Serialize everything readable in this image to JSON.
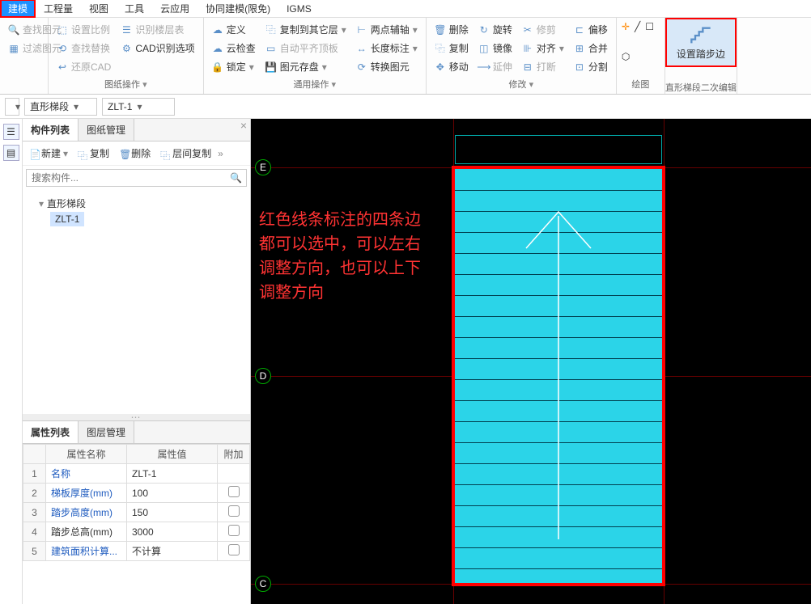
{
  "menu": {
    "tabs": [
      "建模",
      "工程量",
      "视图",
      "工具",
      "云应用",
      "协同建模(限免)",
      "IGMS"
    ],
    "active": 0
  },
  "ribbon": {
    "groups": [
      {
        "label": "",
        "items": [
          {
            "label": "查找图元",
            "icon": "🔍",
            "disabled": true
          },
          {
            "label": "过滤图元",
            "icon": "▦",
            "disabled": true
          }
        ]
      },
      {
        "label": "图纸操作",
        "items": [
          {
            "label": "设置比例",
            "icon": "⬚",
            "disabled": true
          },
          {
            "label": "查找替换",
            "icon": "⟲",
            "disabled": true
          },
          {
            "label": "还原CAD",
            "icon": "↩",
            "disabled": true
          },
          {
            "label": "识别楼层表",
            "icon": "☰",
            "disabled": true
          },
          {
            "label": "CAD识别选项",
            "icon": "⚙",
            "disabled": false
          }
        ]
      },
      {
        "label": "通用操作",
        "items": [
          {
            "label": "定义",
            "icon": "☁",
            "disabled": false
          },
          {
            "label": "云检查",
            "icon": "☁",
            "disabled": false
          },
          {
            "label": "锁定",
            "icon": "🔒",
            "disabled": false
          },
          {
            "label": "复制到其它层",
            "icon": "⿻",
            "disabled": false
          },
          {
            "label": "自动平齐顶板",
            "icon": "▭",
            "disabled": true
          },
          {
            "label": "图元存盘",
            "icon": "💾",
            "disabled": false
          },
          {
            "label": "两点辅轴",
            "icon": "⊢",
            "disabled": false
          },
          {
            "label": "长度标注",
            "icon": "↔",
            "disabled": false
          },
          {
            "label": "转换图元",
            "icon": "⟳",
            "disabled": false
          }
        ]
      },
      {
        "label": "修改",
        "items": [
          {
            "label": "删除",
            "icon": "🗑",
            "disabled": false
          },
          {
            "label": "复制",
            "icon": "⿻",
            "disabled": false
          },
          {
            "label": "移动",
            "icon": "✥",
            "disabled": false
          },
          {
            "label": "旋转",
            "icon": "↻",
            "disabled": false
          },
          {
            "label": "镜像",
            "icon": "◫",
            "disabled": false
          },
          {
            "label": "延伸",
            "icon": "⟶",
            "disabled": true
          },
          {
            "label": "修剪",
            "icon": "✂",
            "disabled": true
          },
          {
            "label": "对齐",
            "icon": "⊪",
            "disabled": false
          },
          {
            "label": "打断",
            "icon": "⊟",
            "disabled": true
          },
          {
            "label": "偏移",
            "icon": "⊏",
            "disabled": false
          },
          {
            "label": "合并",
            "icon": "⊞",
            "disabled": false
          },
          {
            "label": "分割",
            "icon": "⊡",
            "disabled": false
          }
        ]
      },
      {
        "label": "绘图",
        "items": [
          {
            "label": "",
            "icon": "✛",
            "disabled": false
          },
          {
            "label": "",
            "icon": "╱",
            "disabled": false
          },
          {
            "label": "",
            "icon": "☐",
            "disabled": false
          },
          {
            "label": "",
            "icon": "⬡",
            "disabled": false
          }
        ]
      },
      {
        "label": "直形梯段二次编辑",
        "big": true,
        "items": [
          {
            "label": "设置踏步边",
            "icon": "stairs"
          }
        ]
      }
    ]
  },
  "selectors": {
    "dropdown_icon": "▾",
    "s1": "",
    "s2": "直形梯段",
    "s3": "ZLT-1"
  },
  "panel": {
    "tabs": [
      "构件列表",
      "图纸管理"
    ],
    "active": 0,
    "toolbar": [
      {
        "label": "新建",
        "icon": "📄"
      },
      {
        "label": "复制",
        "icon": "⿻"
      },
      {
        "label": "删除",
        "icon": "🗑"
      },
      {
        "label": "层间复制",
        "icon": "⿻"
      }
    ],
    "search_placeholder": "搜索构件...",
    "tree": {
      "root": "直形梯段",
      "children": [
        "ZLT-1"
      ]
    }
  },
  "props": {
    "tabs": [
      "属性列表",
      "图层管理"
    ],
    "active": 0,
    "headers": [
      "",
      "属性名称",
      "属性值",
      "附加"
    ],
    "rows": [
      {
        "idx": "1",
        "name": "名称",
        "value": "ZLT-1",
        "chk": false,
        "link": true
      },
      {
        "idx": "2",
        "name": "梯板厚度(mm)",
        "value": "100",
        "chk": true,
        "link": true
      },
      {
        "idx": "3",
        "name": "踏步高度(mm)",
        "value": "150",
        "chk": true,
        "link": true
      },
      {
        "idx": "4",
        "name": "踏步总高(mm)",
        "value": "3000",
        "chk": true,
        "link": false
      },
      {
        "idx": "5",
        "name": "建筑面积计算...",
        "value": "不计算",
        "chk": true,
        "link": true
      }
    ]
  },
  "canvas": {
    "annotation": "红色线条标注的四条边都可以选中，可以左右调整方向，也可以上下调整方向",
    "grid_labels": {
      "E": "E",
      "D": "D",
      "C": "C"
    }
  }
}
